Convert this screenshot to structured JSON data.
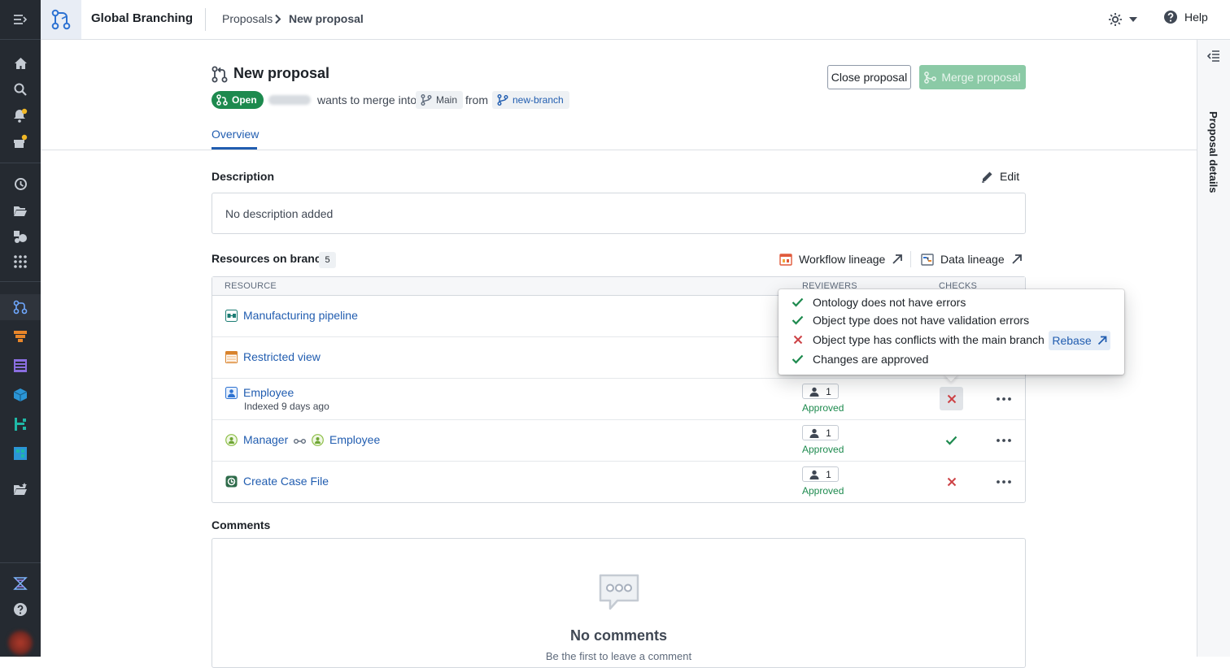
{
  "app": {
    "title": "Global Branching"
  },
  "breadcrumb": {
    "items": [
      "Proposals",
      "New proposal"
    ]
  },
  "topbar": {
    "help_label": "Help"
  },
  "side_panel": {
    "label": "Proposal details"
  },
  "proposal": {
    "title": "New proposal",
    "status": "Open",
    "merge_text": "wants to merge into",
    "target_branch": "Main",
    "from_text": "from",
    "source_branch": "new-branch",
    "close_label": "Close proposal",
    "merge_label": "Merge proposal"
  },
  "tabs": [
    {
      "label": "Overview",
      "active": true
    }
  ],
  "description": {
    "title": "Description",
    "edit_label": "Edit",
    "text": "No description added"
  },
  "resources": {
    "title": "Resources on branch",
    "count": "5",
    "workflow_lineage_label": "Workflow lineage",
    "data_lineage_label": "Data lineage",
    "columns": [
      "RESOURCE",
      "REVIEWERS",
      "CHECKS"
    ],
    "rows": [
      {
        "name": "Manufacturing pipeline",
        "icon": "pipeline-icon"
      },
      {
        "name": "Restricted view",
        "icon": "restricted-view-icon"
      },
      {
        "name": "Employee",
        "subtitle": "Indexed 9 days ago",
        "icon": "object-type-icon",
        "reviewers": "1",
        "review_status": "Approved",
        "check": "fail"
      },
      {
        "name": "Manager",
        "link_to": "Employee",
        "icon": "link-type-icon",
        "reviewers": "1",
        "review_status": "Approved",
        "check": "pass"
      },
      {
        "name": "Create Case File",
        "icon": "action-type-icon",
        "reviewers": "1",
        "review_status": "Approved",
        "check": "fail"
      }
    ]
  },
  "checks_popover": {
    "items": [
      {
        "label": "Ontology does not have errors",
        "status": "pass"
      },
      {
        "label": "Object type does not have validation errors",
        "status": "pass"
      },
      {
        "label": "Object type has conflicts with the main branch",
        "status": "fail"
      },
      {
        "label": "Changes are approved",
        "status": "pass"
      }
    ],
    "rebase_label": "Rebase"
  },
  "comments": {
    "title": "Comments",
    "empty_title": "No comments",
    "empty_subtitle": "Be the first to leave a comment"
  },
  "colors": {
    "accent": "#215db0",
    "success": "#1d8a4e",
    "danger": "#cd4246",
    "rail": "#252a31",
    "merge_disabled": "#8bcaa6"
  }
}
